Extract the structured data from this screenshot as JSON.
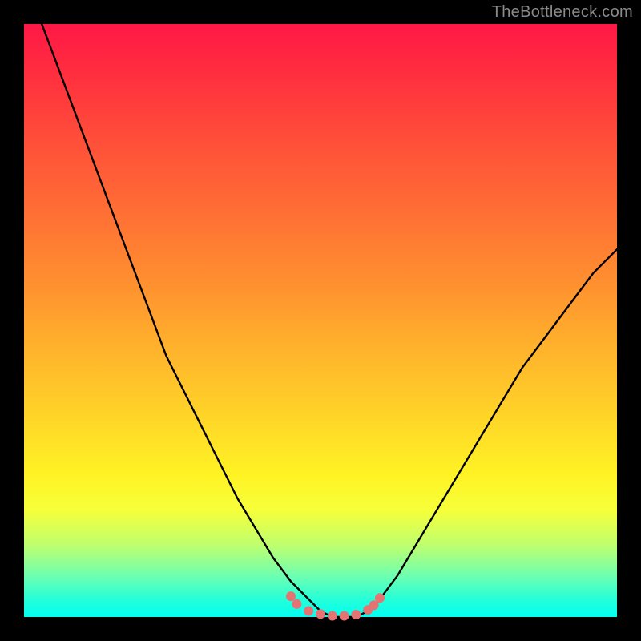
{
  "watermark": "TheBottleneck.com",
  "colors": {
    "background_frame": "#000000",
    "curve_stroke": "#000000",
    "marker_fill": "#e57373",
    "gradient_top": "#ff1846",
    "gradient_bottom": "#02fff3"
  },
  "chart_data": {
    "type": "line",
    "title": "",
    "xlabel": "",
    "ylabel": "",
    "xlim": [
      0,
      100
    ],
    "ylim": [
      0,
      100
    ],
    "x": [
      0,
      3,
      6,
      9,
      12,
      15,
      18,
      21,
      24,
      27,
      30,
      33,
      36,
      39,
      42,
      45,
      48,
      50,
      52,
      54,
      56,
      58,
      60,
      63,
      66,
      69,
      72,
      75,
      78,
      81,
      84,
      87,
      90,
      93,
      96,
      100
    ],
    "values": [
      108,
      100,
      92,
      84,
      76,
      68,
      60,
      52,
      44,
      38,
      32,
      26,
      20,
      15,
      10,
      6,
      3,
      1,
      0,
      0,
      0,
      1,
      3,
      7,
      12,
      17,
      22,
      27,
      32,
      37,
      42,
      46,
      50,
      54,
      58,
      62
    ],
    "markers": {
      "x": [
        45,
        46,
        48,
        50,
        52,
        54,
        56,
        58,
        59,
        60
      ],
      "y": [
        3.5,
        2.2,
        1.0,
        0.5,
        0.2,
        0.2,
        0.4,
        1.2,
        2.0,
        3.2
      ]
    },
    "note": "Axis values are estimated on a 0–100 scale; the curve is a steep V shape bottoming near x≈52–54 against a vertical rainbow gradient (red top → cyan bottom)."
  }
}
